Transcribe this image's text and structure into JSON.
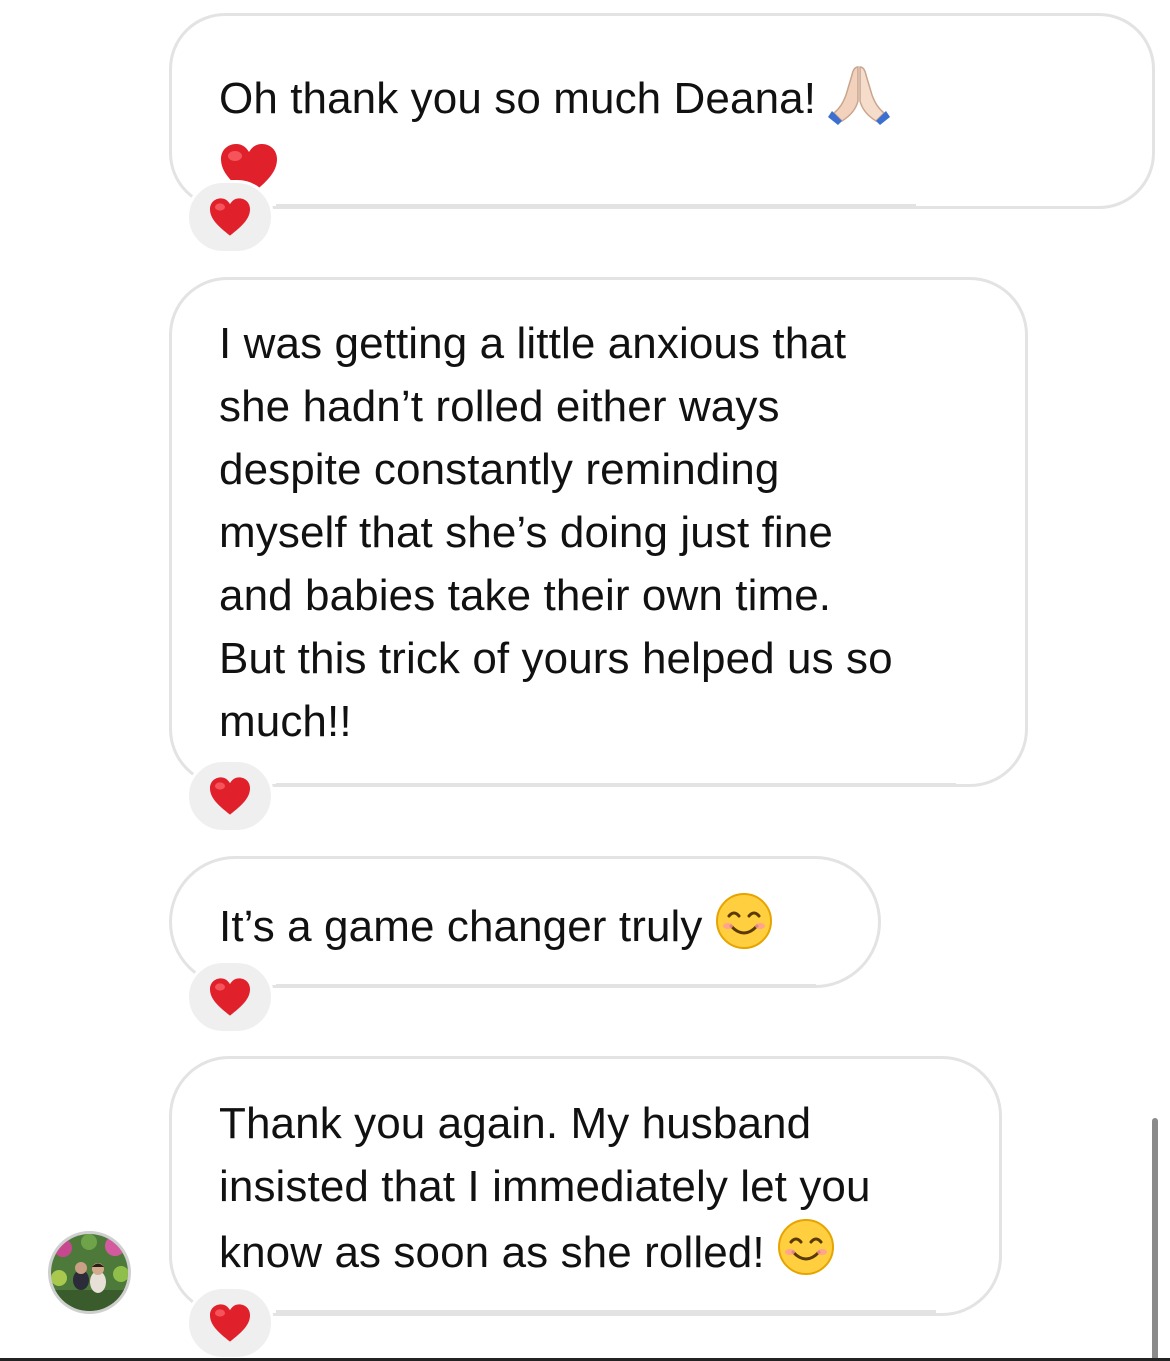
{
  "messages": [
    {
      "text": "Oh thank you so much Deana! ",
      "text2": "",
      "end_emoji": "folded-hands",
      "reaction": "heart"
    },
    {
      "text": "I was getting a little anxious that\nshe hadn’t rolled either ways\ndespite constantly reminding\nmyself that she’s doing just fine\nand babies take their own time.\nBut this trick of yours helped us so\nmuch!!",
      "reaction": "heart"
    },
    {
      "text": "It’s a game changer truly ",
      "end_emoji": "smiling-face",
      "reaction": "heart"
    },
    {
      "text": "Thank you again. My husband\ninsisted that I immediately let you\nknow as soon as she rolled! ",
      "end_emoji": "smiling-face",
      "reaction": "heart"
    }
  ],
  "icons": {
    "reaction": "red-heart-icon",
    "avatar": "profile-avatar"
  },
  "colors": {
    "bubble_border": "#e3e3e3",
    "reaction_bg": "#efefef",
    "heart": "#e0202a",
    "text": "#111111"
  }
}
